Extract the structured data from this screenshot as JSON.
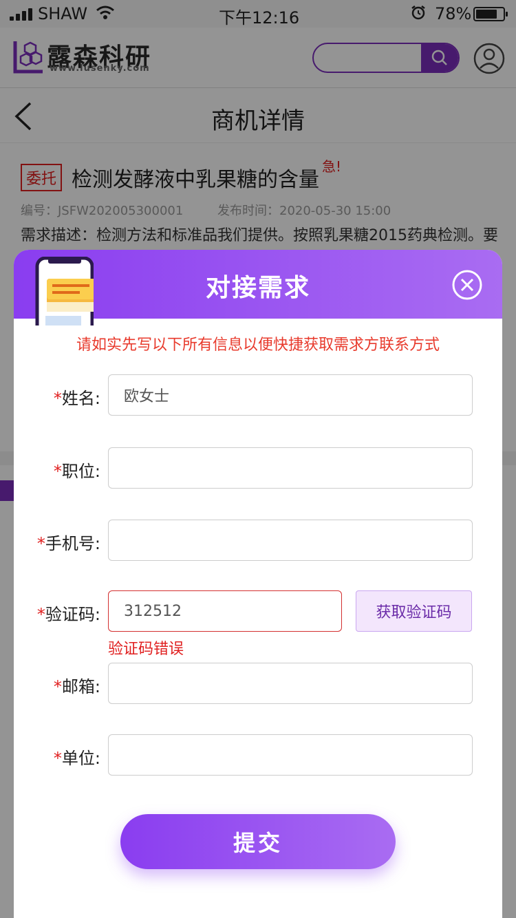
{
  "status_bar": {
    "carrier": "SHAW",
    "time": "下午12:16",
    "battery": "78%",
    "battery_level": 0.78
  },
  "header": {
    "logo_name": "露森科研",
    "logo_url": "www.lusenky.com",
    "brand_color": "#7b2dbc"
  },
  "nav": {
    "title": "商机详情"
  },
  "detail": {
    "tag": "委托",
    "title": "检测发酵液中乳果糖的含量",
    "urgent": "急!",
    "number": "编号：JSFW202005300001",
    "publish_time": "发布时间：2020-05-30  15:00",
    "description": "需求描述：检测方法和标准品我们提供。按照乳果糖2015药典检测。要"
  },
  "modal": {
    "title": "对接需求",
    "notice": "请如实先写以下所有信息以便快捷获取需求方联系方式",
    "fields": {
      "name": {
        "label": "姓名:",
        "value": "欧女士"
      },
      "position": {
        "label": "职位:",
        "value": ""
      },
      "phone": {
        "label": "手机号:",
        "value": ""
      },
      "code": {
        "label": "验证码:",
        "value": "312512",
        "error": "验证码错误",
        "button": "获取验证码"
      },
      "email": {
        "label": "邮箱:",
        "value": ""
      },
      "company": {
        "label": "单位:",
        "value": ""
      }
    },
    "required_mark": "*",
    "submit": "提交",
    "accent": "#8a3df0",
    "error_color": "#e02020"
  }
}
